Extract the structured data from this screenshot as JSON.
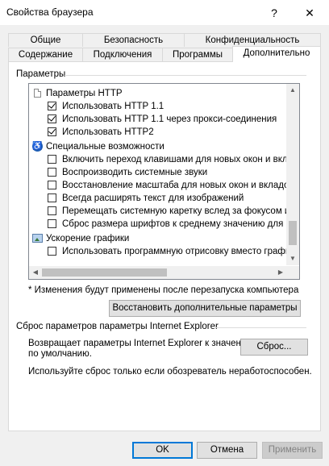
{
  "window": {
    "title": "Свойства браузера",
    "help_glyph": "?",
    "close_glyph": "✕"
  },
  "tabs_row1": [
    "Общие",
    "Безопасность",
    "Конфиденциальность"
  ],
  "tabs_row2": [
    "Содержание",
    "Подключения",
    "Программы",
    "Дополнительно"
  ],
  "settings_section": "Параметры",
  "tree": {
    "rows": [
      {
        "kind": "group",
        "icon": "document-icon",
        "label": "Параметры HTTP"
      },
      {
        "kind": "check",
        "checked": true,
        "label": "Использовать HTTP 1.1"
      },
      {
        "kind": "check",
        "checked": true,
        "label": "Использовать HTTP 1.1 через прокси-соединения"
      },
      {
        "kind": "check",
        "checked": true,
        "label": "Использовать HTTP2"
      },
      {
        "kind": "group",
        "icon": "accessibility-icon",
        "label": "Специальные возможности"
      },
      {
        "kind": "check",
        "checked": false,
        "label": "Включить переход клавишами для новых окон и вклад"
      },
      {
        "kind": "check",
        "checked": false,
        "label": "Воспроизводить системные звуки"
      },
      {
        "kind": "check",
        "checked": false,
        "label": "Восстановление масштаба для новых окон и вкладок"
      },
      {
        "kind": "check",
        "checked": false,
        "label": "Всегда расширять текст для изображений"
      },
      {
        "kind": "check",
        "checked": false,
        "label": "Перемещать системную каретку вслед за фокусом и в"
      },
      {
        "kind": "check",
        "checked": false,
        "label": "Сброс размера шрифтов к среднему значению для нов"
      },
      {
        "kind": "group",
        "icon": "graphics-icon",
        "label": "Ускорение графики"
      },
      {
        "kind": "check",
        "checked": false,
        "label": "Использовать программную отрисовку вместо графи"
      }
    ]
  },
  "restart_note": "* Изменения будут применены после перезапуска компьютера",
  "restore_button": "Восстановить дополнительные параметры",
  "reset_section": "Сброс параметров параметры Internet Explorer",
  "reset_desc_line1": "Возвращает параметры Internet Explorer к значениям",
  "reset_desc_line2": "по умолчанию.",
  "reset_button": "Сброс...",
  "reset_hint": "Используйте сброс только если обозреватель неработоспособен.",
  "footer": {
    "ok": "OK",
    "cancel": "Отмена",
    "apply": "Применить"
  }
}
